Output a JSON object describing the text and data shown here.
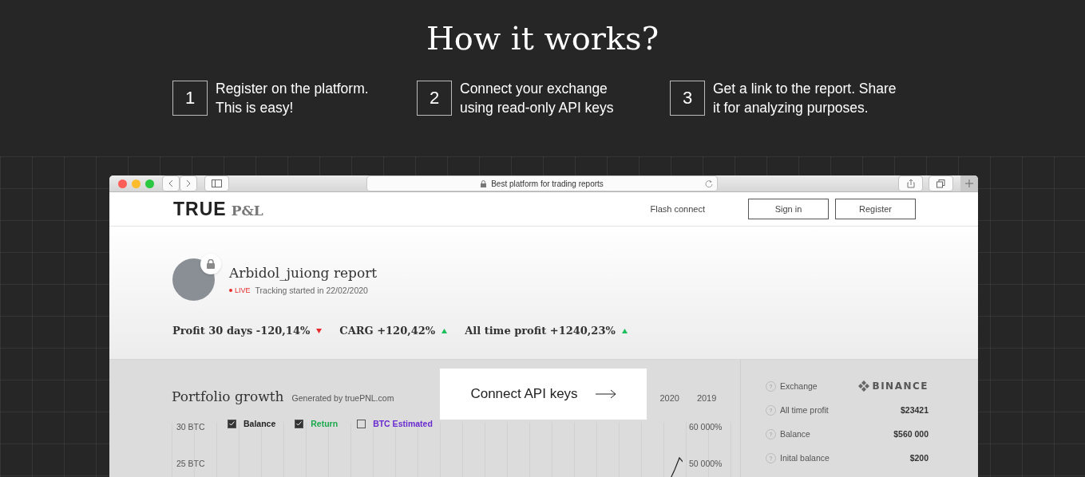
{
  "heading": "How it works?",
  "steps": [
    {
      "number": "1",
      "lines": [
        "Register on the platform.",
        "This is easy!"
      ]
    },
    {
      "number": "2",
      "lines": [
        "Connect your exchange",
        "using read-only API keys"
      ]
    },
    {
      "number": "3",
      "lines": [
        "Get a link to the report. Share",
        "it for analyzing purposes."
      ]
    }
  ],
  "browser": {
    "address": "Best platform for trading reports"
  },
  "site": {
    "logo_main": "TRUE",
    "logo_sub": "P&L",
    "nav_link": "Flash connect",
    "buttons": [
      "Sign in",
      "Register"
    ]
  },
  "report": {
    "title": "Arbidol_juiong report",
    "live": "LIVE",
    "tracking": "Tracking started in 22/02/2020",
    "stats": [
      {
        "text": "Profit 30 days -120,14%",
        "rising": false
      },
      {
        "text": "CARG +120,42%",
        "rising": true
      },
      {
        "text": "All time profit +1240,23%",
        "rising": true
      }
    ]
  },
  "portfolio": {
    "title": "Portfolio growth",
    "subtitle": "Generated by truePNL.com",
    "years": [
      "2020",
      "2019"
    ],
    "left_ticks": [
      "30 BTC",
      "25 BTC"
    ],
    "right_ticks": [
      "60 000%",
      "50 000%"
    ],
    "legend": [
      {
        "label": "Balance",
        "checked": true,
        "color": "#222222"
      },
      {
        "label": "Return",
        "checked": true,
        "color": "#1aa94b"
      },
      {
        "label": "BTC Estimated",
        "checked": false,
        "color": "#6a2bd0"
      }
    ]
  },
  "overlay": {
    "label": "Connect API keys"
  },
  "summary": [
    {
      "help": "?",
      "label": "Exchange",
      "kind": "logo",
      "value": "BINANCE"
    },
    {
      "help": "?",
      "label": "All time profit",
      "kind": "text",
      "value": "$23421"
    },
    {
      "help": "?",
      "label": "Balance",
      "kind": "text",
      "value": "$560 000"
    },
    {
      "help": "?",
      "label": "Inital balance",
      "kind": "text",
      "value": "$200"
    }
  ]
}
